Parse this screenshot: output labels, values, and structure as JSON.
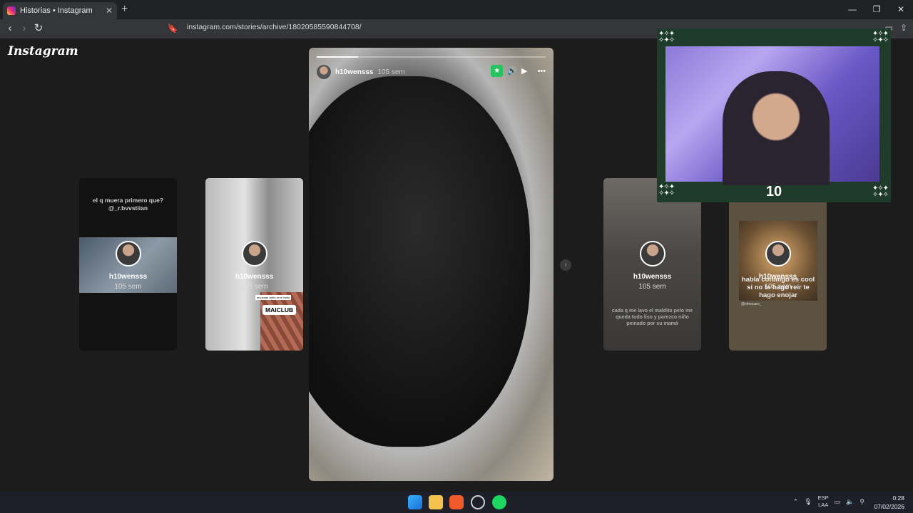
{
  "browser": {
    "tab_title": "Historias • Instagram",
    "tab_close": "✕",
    "new_tab": "+",
    "url": "instagram.com/stories/archive/18020585590844708/",
    "window_controls": [
      "—",
      "❐",
      "✕"
    ]
  },
  "page": {
    "logo": "Instagram"
  },
  "stories": [
    {
      "caption": "el q muera primero que?\n@_r.bvvstiian",
      "user": "h10wensss",
      "time": "105 sem"
    },
    {
      "user": "h10wensss",
      "time": "105 sem",
      "tag": "MAICLUB",
      "sub": "se posan rarito en el baño"
    },
    {
      "user": "h10wensss",
      "time": "105 sem",
      "caption": "cada q me lavo el maldito pelo me queda todo liso y parezco niño peinado por su mamá"
    },
    {
      "user": "h10wensss",
      "time": "105 sem",
      "caption": "habla conmigo es cool si no te hago reir te hago enojar",
      "mention": "@elmocaro_"
    }
  ],
  "active_story": {
    "user": "h10wensss",
    "time": "105 sem",
    "progress": 0.18,
    "star_icon": "★",
    "sound_icon": "🔊",
    "play_icon": "▶",
    "more_icon": "•••"
  },
  "next_arrow": "›",
  "webcam": {
    "counter": "10"
  },
  "taskbar": {
    "lang_top": "ESP",
    "lang_bottom": "LAA",
    "time": "0:28",
    "date": "07/02/2026"
  }
}
